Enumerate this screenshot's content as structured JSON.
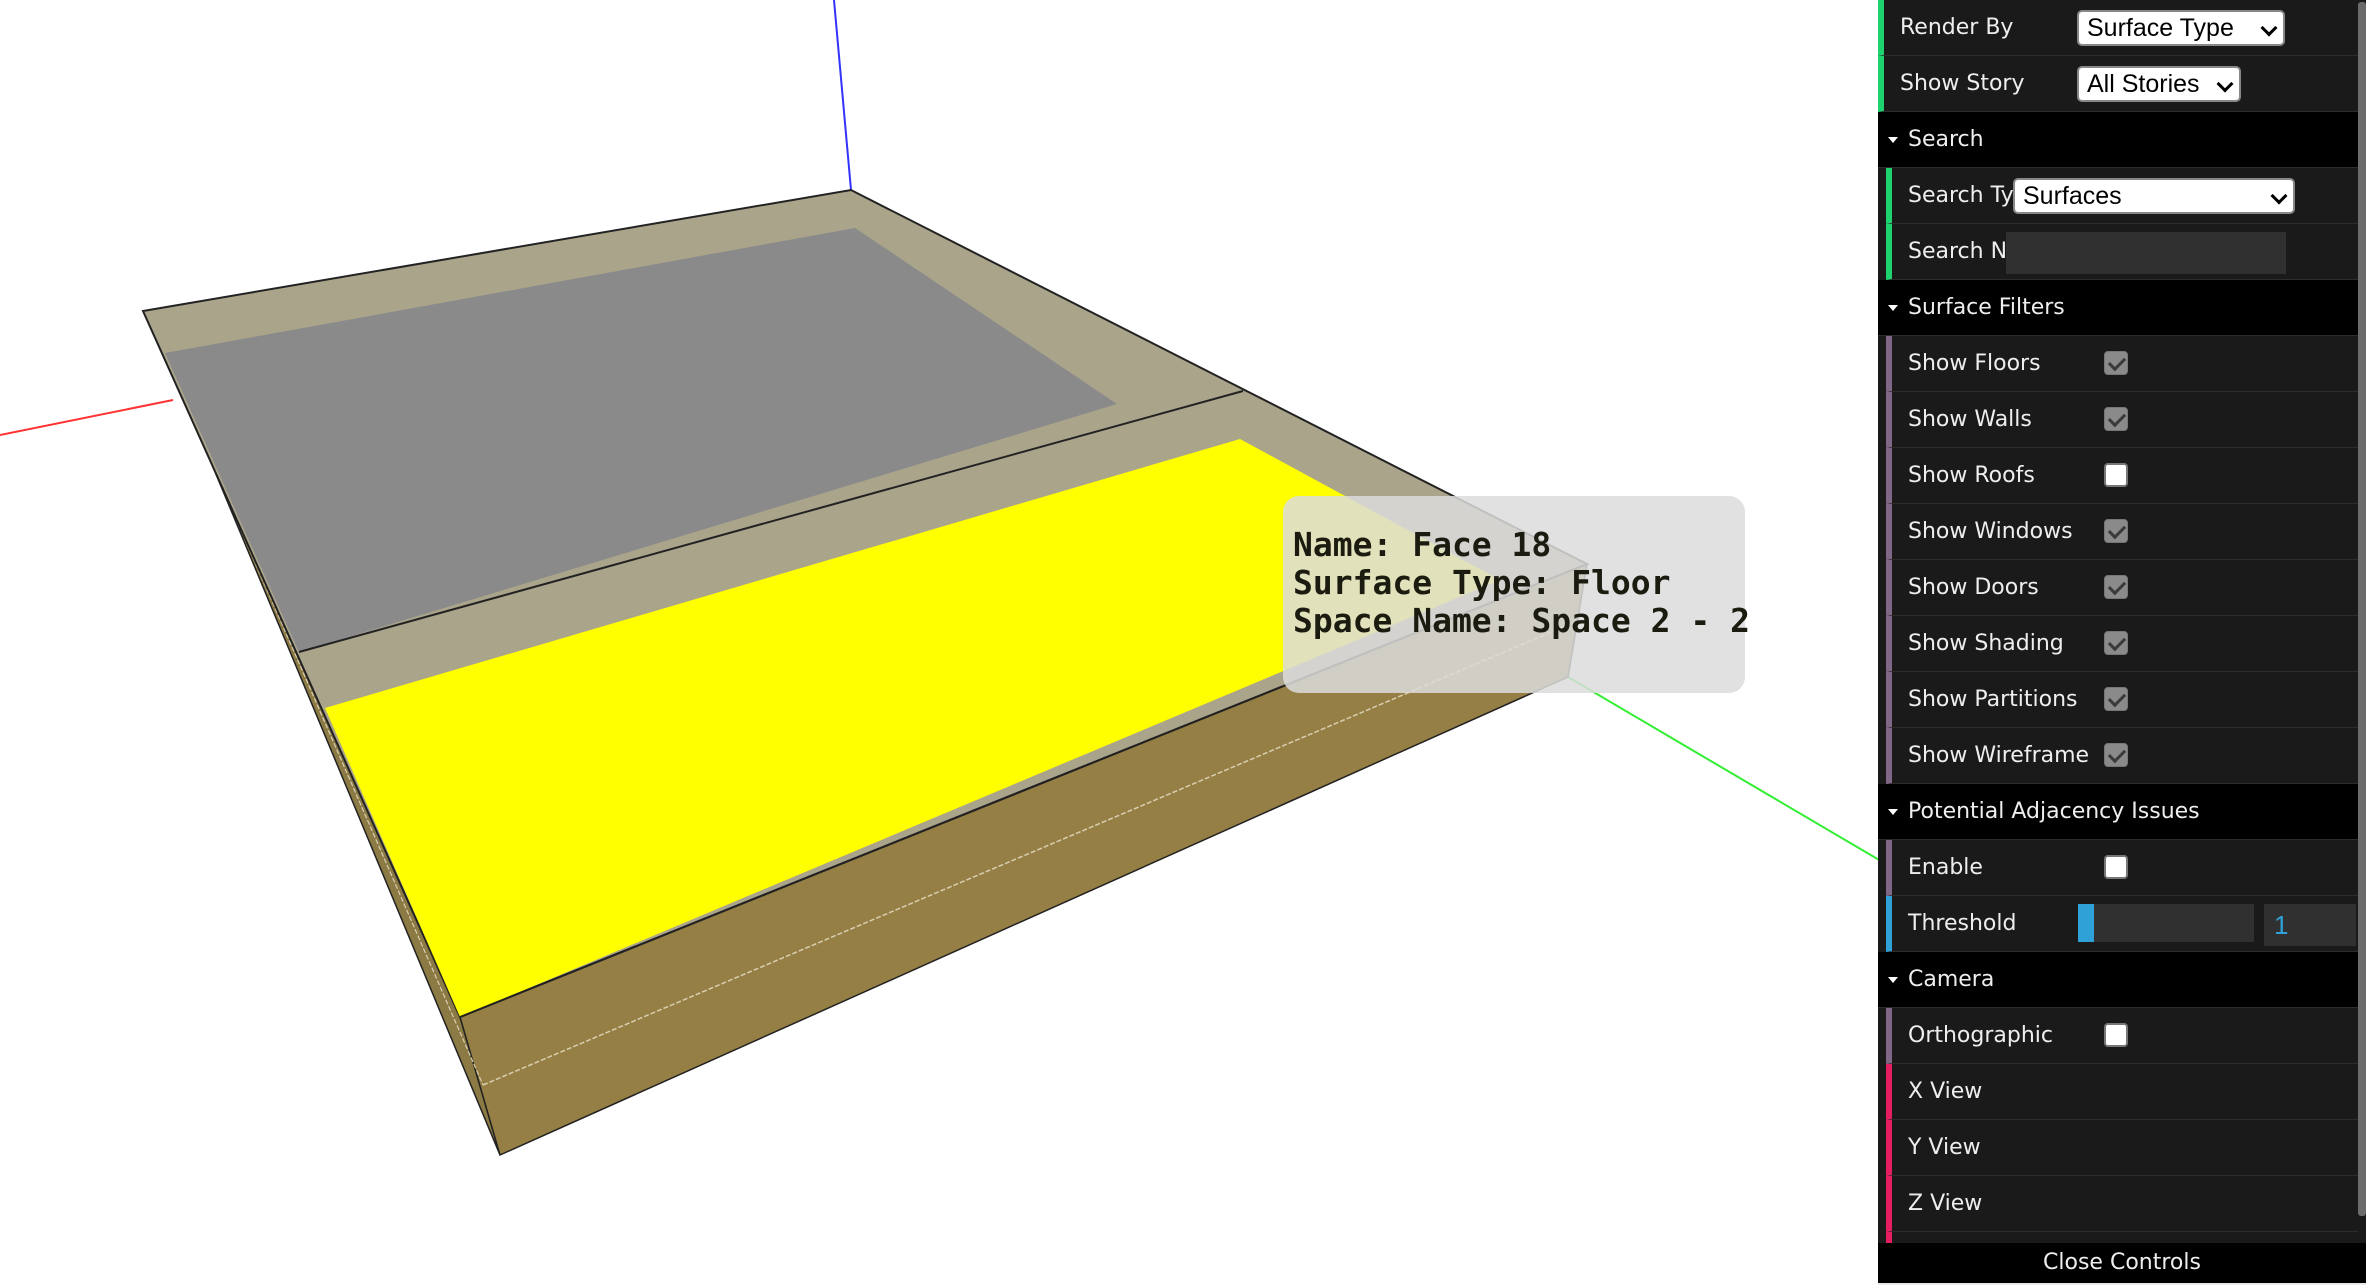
{
  "scene": {
    "colors": {
      "background": "#ffffff",
      "floor_selected": "#ffff00",
      "floor_other": "#8a8a8a",
      "slab_top": "#aaa48b",
      "slab_side": "#957f45",
      "edge": "#222222",
      "axis_x": "#ff3333",
      "axis_y": "#33ee33",
      "axis_z": "#3333ff"
    }
  },
  "tooltip": {
    "name_line": "Name: Face 18",
    "type_line": "Surface Type: Floor",
    "space_line": "Space Name: Space 2 - 2"
  },
  "controls": {
    "render_by": {
      "label": "Render By",
      "value": "Surface Type"
    },
    "show_story": {
      "label": "Show Story",
      "value": "All Stories"
    },
    "search": {
      "title": "Search",
      "search_type": {
        "label": "Search Type",
        "value": "Surfaces"
      },
      "search_name": {
        "label": "Search Name",
        "value": ""
      }
    },
    "surface_filters": {
      "title": "Surface Filters",
      "items": [
        {
          "label": "Show Floors",
          "checked": true
        },
        {
          "label": "Show Walls",
          "checked": true
        },
        {
          "label": "Show Roofs",
          "checked": false
        },
        {
          "label": "Show Windows",
          "checked": true
        },
        {
          "label": "Show Doors",
          "checked": true
        },
        {
          "label": "Show Shading",
          "checked": true
        },
        {
          "label": "Show Partitions",
          "checked": true
        },
        {
          "label": "Show Wireframe",
          "checked": true
        }
      ]
    },
    "adjacency": {
      "title": "Potential Adjacency Issues",
      "enable": {
        "label": "Enable",
        "checked": false
      },
      "threshold": {
        "label": "Threshold",
        "value": "1",
        "slider_fraction": 0.09
      }
    },
    "camera": {
      "title": "Camera",
      "orthographic": {
        "label": "Orthographic",
        "checked": false
      },
      "x_view": "X View",
      "y_view": "Y View",
      "z_view": "Z View"
    },
    "close_label": "Close Controls"
  }
}
